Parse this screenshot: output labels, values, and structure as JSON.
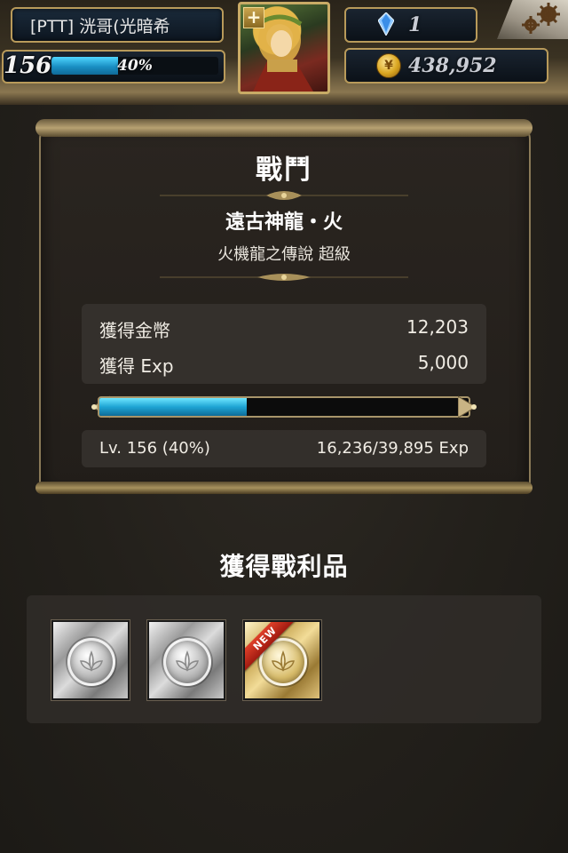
{
  "status_bar": {
    "player_name": "[PTT] 洸哥(光暗希",
    "level": "156",
    "level_progress_label": "40%",
    "level_progress_fraction": 0.4,
    "gems": "1",
    "gold": "438,952",
    "portrait_badge": "+"
  },
  "battle": {
    "title": "戰鬥",
    "boss_name": "遠古神龍・火",
    "boss_subtitle": "火機龍之傳說 超級",
    "rewards": [
      {
        "label": "獲得金幣",
        "value": "12,203"
      },
      {
        "label": "獲得 Exp",
        "value": "5,000"
      }
    ],
    "exp_bar_fraction": 0.4,
    "level_text": "Lv. 156 (40%)",
    "exp_text": "16,236/39,895 Exp"
  },
  "loot": {
    "title": "獲得戰利品",
    "items": [
      {
        "kind": "silver-coin-card",
        "is_new": false
      },
      {
        "kind": "silver-coin-card",
        "is_new": false
      },
      {
        "kind": "gold-coin-card",
        "is_new": true,
        "badge": "NEW"
      }
    ]
  },
  "colors": {
    "exp_fill": "#1ea4d4",
    "frame_gold": "#b89a5a",
    "new_badge": "#c8281a"
  }
}
